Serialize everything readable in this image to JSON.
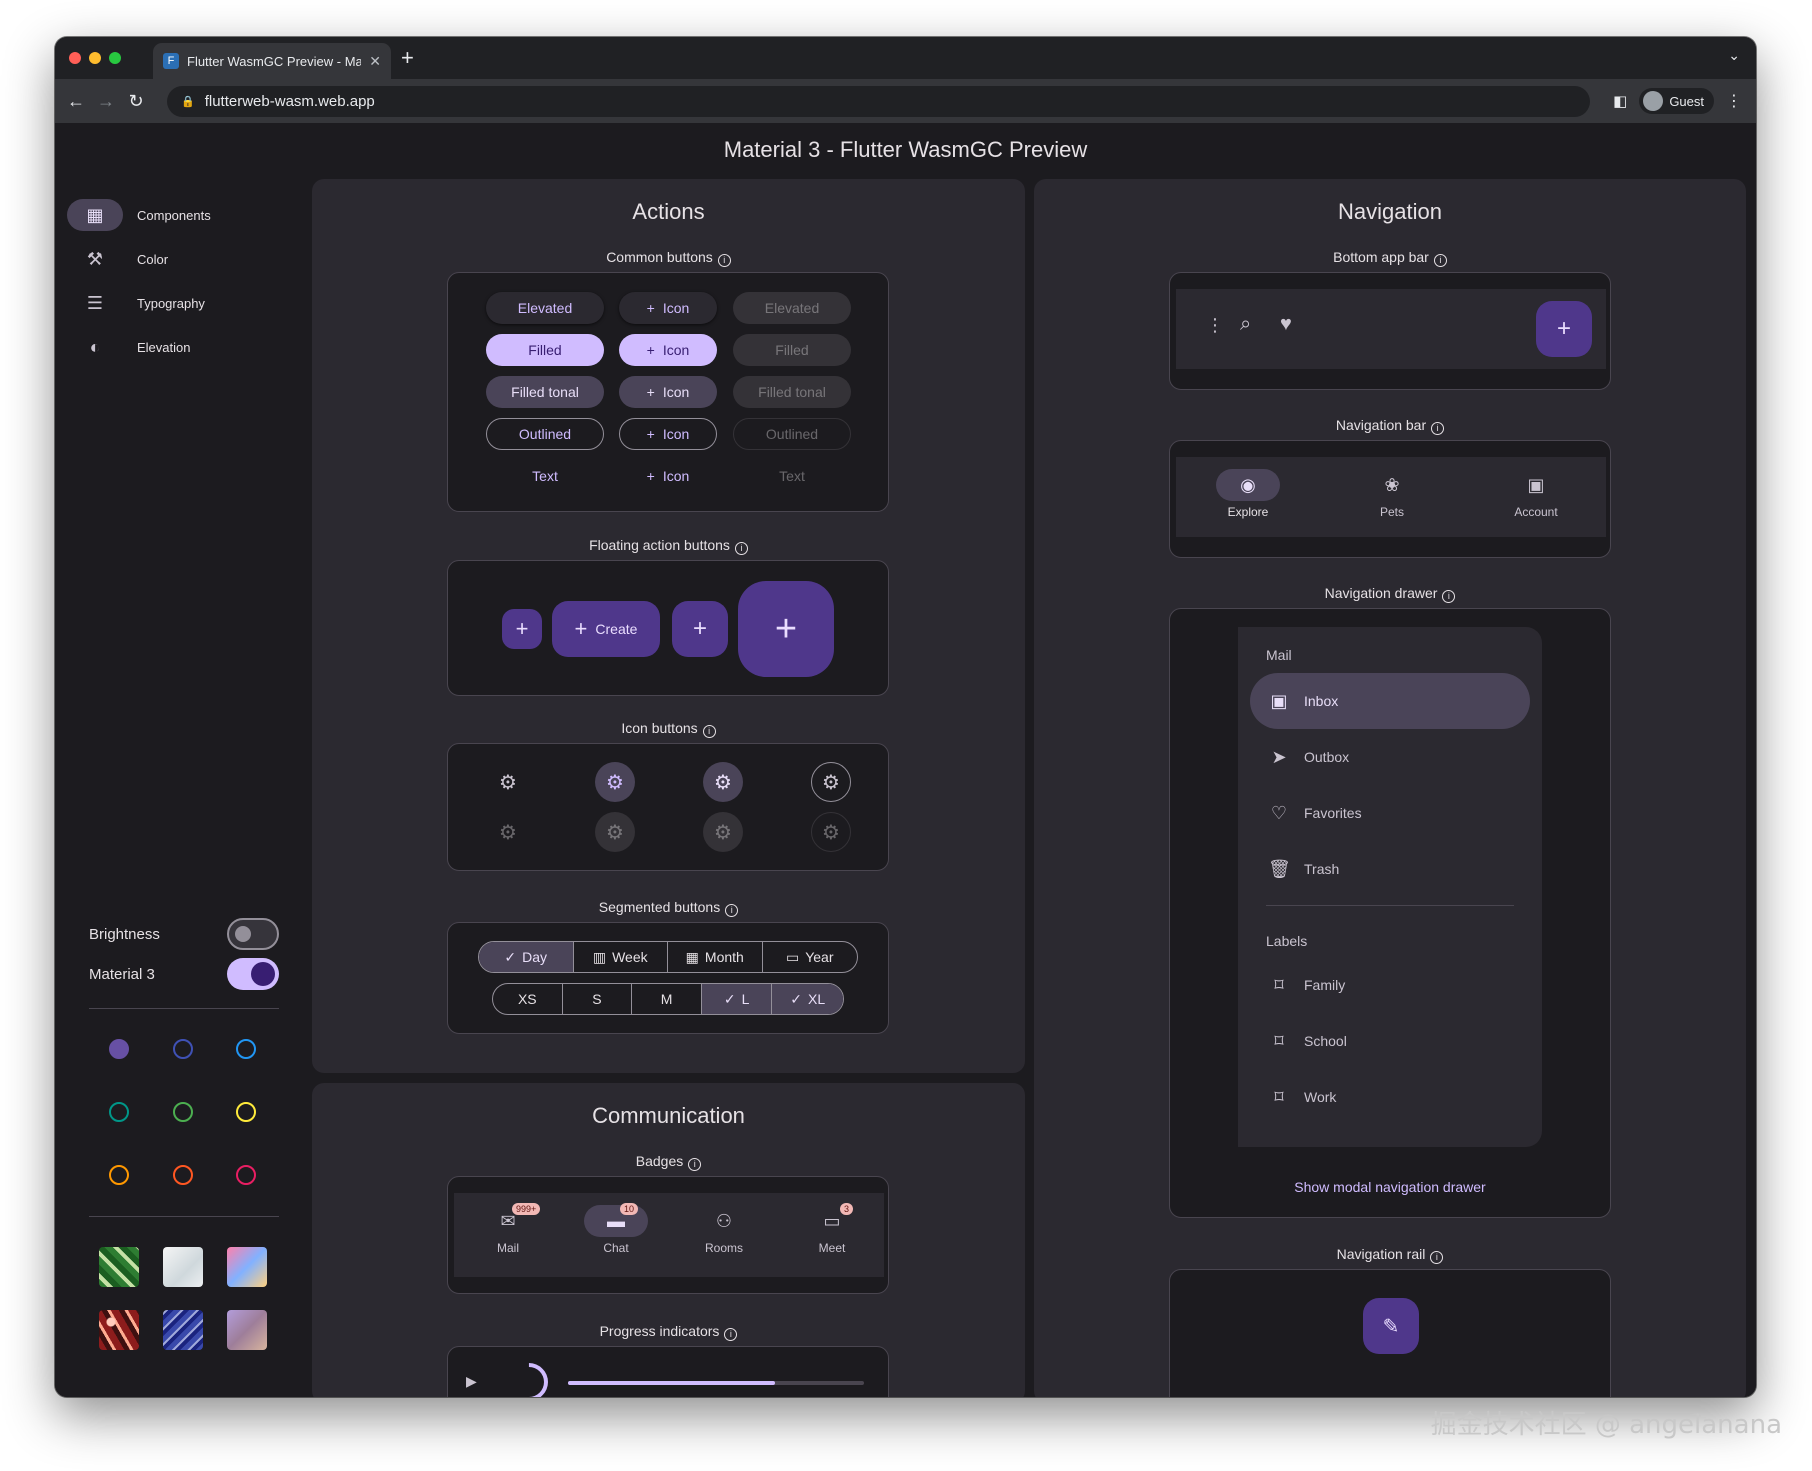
{
  "browser": {
    "tab_title": "Flutter WasmGC Preview - Ma",
    "url": "flutterweb-wasm.web.app",
    "profile_label": "Guest"
  },
  "app": {
    "title": "Material 3 - Flutter WasmGC Preview"
  },
  "sidebar": {
    "items": [
      {
        "label": "Components",
        "icon": "widgets-icon",
        "active": true
      },
      {
        "label": "Color",
        "icon": "format-paint-icon",
        "active": false
      },
      {
        "label": "Typography",
        "icon": "article-icon",
        "active": false
      },
      {
        "label": "Elevation",
        "icon": "invert-colors-icon",
        "active": false
      }
    ],
    "brightness_label": "Brightness",
    "material3_label": "Material 3",
    "brightness_on": false,
    "material3_on": true,
    "color_seeds": [
      "#6750a4",
      "#3f51b5",
      "#2196f3",
      "#009688",
      "#4caf50",
      "#ffeb3b",
      "#ff9800",
      "#ff5722",
      "#e91e63"
    ]
  },
  "actions": {
    "title": "Actions",
    "common_buttons": {
      "title": "Common buttons",
      "rows": [
        {
          "enabled": "Elevated",
          "icon": "Icon",
          "disabled": "Elevated"
        },
        {
          "enabled": "Filled",
          "icon": "Icon",
          "disabled": "Filled"
        },
        {
          "enabled": "Filled tonal",
          "icon": "Icon",
          "disabled": "Filled tonal"
        },
        {
          "enabled": "Outlined",
          "icon": "Icon",
          "disabled": "Outlined"
        },
        {
          "enabled": "Text",
          "icon": "Icon",
          "disabled": "Text"
        }
      ]
    },
    "fab": {
      "title": "Floating action buttons",
      "extended_label": "Create"
    },
    "icon_buttons": {
      "title": "Icon buttons"
    },
    "segmented": {
      "title": "Segmented buttons",
      "single": [
        "Day",
        "Week",
        "Month",
        "Year"
      ],
      "single_selected": "Day",
      "multi": [
        "XS",
        "S",
        "M",
        "L",
        "XL"
      ],
      "multi_selected": [
        "L",
        "XL"
      ]
    }
  },
  "communication": {
    "title": "Communication",
    "badges": {
      "title": "Badges",
      "items": [
        {
          "label": "Mail",
          "badge": "999+"
        },
        {
          "label": "Chat",
          "badge": "10"
        },
        {
          "label": "Rooms",
          "badge": ""
        },
        {
          "label": "Meet",
          "badge": "3"
        }
      ]
    },
    "progress": {
      "title": "Progress indicators",
      "linear_value": 0.7
    }
  },
  "navigation": {
    "title": "Navigation",
    "bottom_app_bar": {
      "title": "Bottom app bar"
    },
    "navigation_bar": {
      "title": "Navigation bar",
      "items": [
        {
          "label": "Explore",
          "icon": "explore-icon",
          "selected": true
        },
        {
          "label": "Pets",
          "icon": "pets-icon",
          "selected": false
        },
        {
          "label": "Account",
          "icon": "account-box-icon",
          "selected": false
        }
      ]
    },
    "navigation_drawer": {
      "title": "Navigation drawer",
      "mail_header": "Mail",
      "mail_items": [
        {
          "label": "Inbox",
          "icon": "inbox-icon",
          "selected": true
        },
        {
          "label": "Outbox",
          "icon": "send-icon",
          "selected": false
        },
        {
          "label": "Favorites",
          "icon": "favorite-icon",
          "selected": false
        },
        {
          "label": "Trash",
          "icon": "delete-icon",
          "selected": false
        }
      ],
      "labels_header": "Labels",
      "label_items": [
        "Family",
        "School",
        "Work"
      ],
      "modal_link": "Show modal navigation drawer"
    },
    "navigation_rail": {
      "title": "Navigation rail"
    }
  },
  "watermark": "掘金技术社区 @ angelanana"
}
